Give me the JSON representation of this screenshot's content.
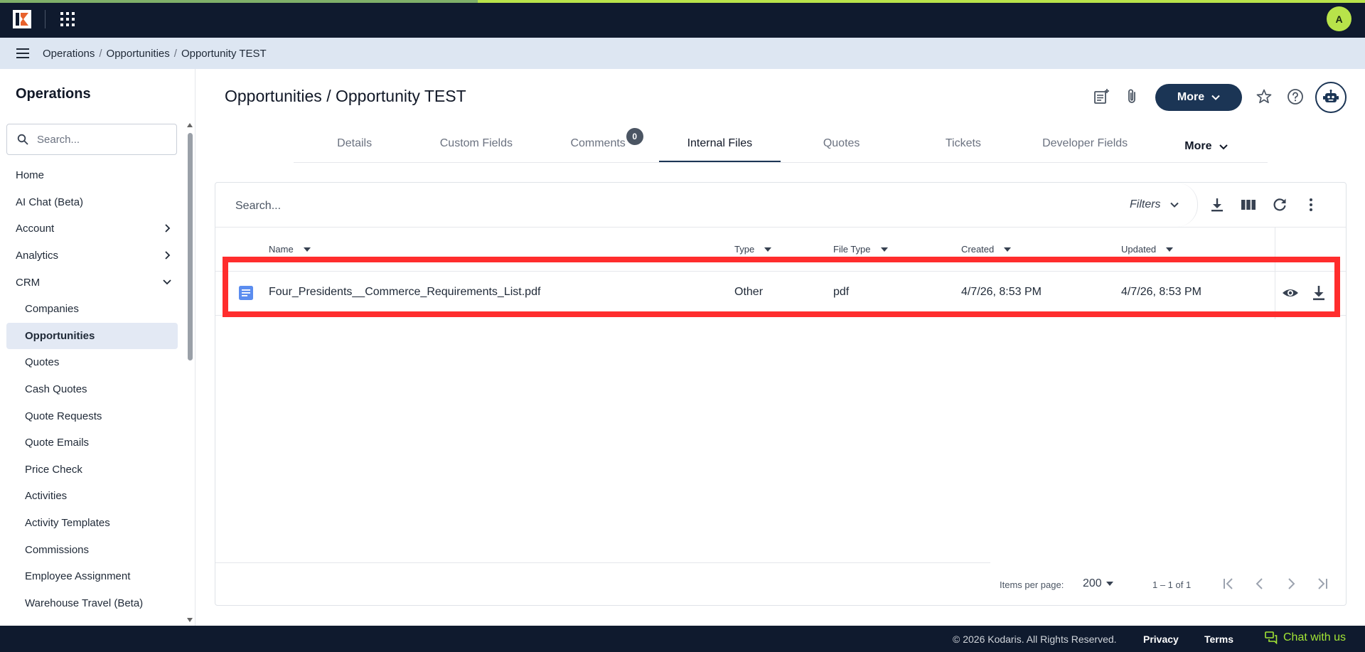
{
  "app": {
    "avatar_initial": "A",
    "accent": "#b8e34a",
    "nav_dark": "#0f1a2e",
    "primary": "#1b3555"
  },
  "breadcrumb": [
    "Operations",
    "Opportunities",
    "Opportunity TEST"
  ],
  "breadcrumb_sep": "/",
  "sidebar": {
    "title": "Operations",
    "search_placeholder": "Search...",
    "items": [
      {
        "label": "Home"
      },
      {
        "label": "AI Chat (Beta)"
      },
      {
        "label": "Account",
        "icon": "chevron-right-icon"
      },
      {
        "label": "Analytics",
        "icon": "chevron-right-icon"
      },
      {
        "label": "CRM",
        "icon": "chevron-down-icon"
      },
      {
        "label": "Companies"
      },
      {
        "label": "Opportunities"
      },
      {
        "label": "Quotes"
      },
      {
        "label": "Cash Quotes"
      },
      {
        "label": "Quote Requests"
      },
      {
        "label": "Quote Emails"
      },
      {
        "label": "Price Check"
      },
      {
        "label": "Activities"
      },
      {
        "label": "Activity Templates"
      },
      {
        "label": "Commissions"
      },
      {
        "label": "Employee Assignment"
      },
      {
        "label": "Warehouse Travel (Beta)"
      }
    ]
  },
  "header": {
    "title": "Opportunities / Opportunity TEST",
    "more_label": "More"
  },
  "tabs": [
    {
      "label": "Details"
    },
    {
      "label": "Custom Fields"
    },
    {
      "label": "Comments",
      "badge": "0"
    },
    {
      "label": "Internal Files"
    },
    {
      "label": "Quotes"
    },
    {
      "label": "Tickets"
    },
    {
      "label": "Developer Fields"
    },
    {
      "label": "More"
    }
  ],
  "table": {
    "search_placeholder": "Search...",
    "filters_label": "Filters",
    "columns": [
      "Name",
      "Type",
      "File Type",
      "Created",
      "Updated"
    ],
    "rows": [
      {
        "name": "Four_Presidents__Commerce_Requirements_List.pdf",
        "type": "Other",
        "file_type": "pdf",
        "created": "4/7/26, 8:53 PM",
        "updated": "4/7/26, 8:53 PM"
      }
    ],
    "pager": {
      "items_per_page_label": "Items per page:",
      "items_per_page": "200",
      "range": "1 – 1 of 1"
    }
  },
  "footer": {
    "copyright": "© 2026 Kodaris. All Rights Reserved.",
    "privacy": "Privacy",
    "terms": "Terms",
    "chat": "Chat with us"
  }
}
